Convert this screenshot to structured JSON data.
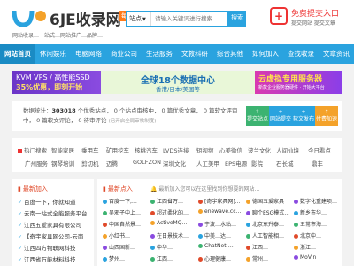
{
  "header": {
    "site_title": "6JE收录网",
    "badge": "每日网",
    "slogan": "网站收录…一站式…网站推广…品牌…",
    "search": {
      "category": "站点",
      "placeholder": "请输入关键词进行搜索",
      "button": "搜索"
    },
    "join": {
      "title": "免费提交入口",
      "subtitle": "提交网站 提交文章"
    }
  },
  "nav": {
    "items": [
      "网站首页",
      "休闲娱乐",
      "电脑网络",
      "商业公司",
      "生活服务",
      "文教科研",
      "综合其他",
      "如何加入",
      "查找收录",
      "文章资讯"
    ]
  },
  "banner": {
    "left_line1": "KVM VPS / 高性能SSD",
    "left_line2": "35%优惠，即刻开始",
    "mid_line1": "全球18个数据中心",
    "mid_line2": "香港/日本/美国等",
    "right_line1": "云虚拟专用服务器",
    "right_line2": "新款企业服务器硬件 · 开始大平台"
  },
  "stats": {
    "label": "数据统计：",
    "total": "303018",
    "text": "个优秀站点， 0 个站点审核中， 0 篇优秀文章， 0 篇软文评审中， 0 篇软文评论， 0 待审评论",
    "note": "(已开启全局审核制度)",
    "buttons": [
      "提交站点",
      "网站提交",
      "软文发布",
      "付费加速"
    ]
  },
  "tags": {
    "row1": [
      "热门搜索",
      "智能家居",
      "乘用车",
      "矿用挖车",
      "核桃汽车",
      "LVDS连接",
      "短视频",
      "心美微信",
      "波兰文化",
      "人间仙境",
      "今日看点"
    ],
    "row2": [
      "广州服务",
      "钢琴培训",
      "剪切机",
      "迈腾",
      "GOLFZON",
      "深圳文化",
      "人工美甲",
      "EPS电源",
      "影院",
      "石长城",
      "鼎丰"
    ]
  },
  "left_panel": {
    "title": "最新加入",
    "items": [
      "百度一下，你就知道",
      "云南一站式全能服务平台…",
      "江西五爱家具有限公司",
      "【奇宇家具网公司-云南",
      "江西四方物联网科技",
      "江西省万能材料科技"
    ]
  },
  "right_panel": {
    "title": "最新点入",
    "notice": "最新加入您可以在这里找到你想要的网站…",
    "rows": [
      [
        "百度一下,…",
        "江西省万…",
        "[奇宇家具网]…",
        "德国五爱家具",
        "数字化重建项…"
      ],
      [
        "吴邪子中上…",
        "超过柔化的…",
        "enewave.cc…",
        "聊个ESG模式…",
        "新乡市华…"
      ],
      [
        "中国自然景…",
        "ActiveMQ…",
        "宁波…水站…",
        "北京东升泰…",
        "五常市海…"
      ],
      [
        "小红书…",
        "在日景技术…",
        "中美…达…",
        "人工智能相…",
        "北京中…"
      ],
      [
        "山西国新…",
        "中华…",
        "ChatNet-…",
        "江西…",
        "浙江…"
      ],
      [
        "梦州…",
        "江西…",
        "心理健康…",
        "常州…",
        "MoVin"
      ]
    ]
  },
  "colors": {
    "primary": "#2aa3df",
    "accent": "#e04a2a",
    "badge": "#ff7a1a"
  }
}
